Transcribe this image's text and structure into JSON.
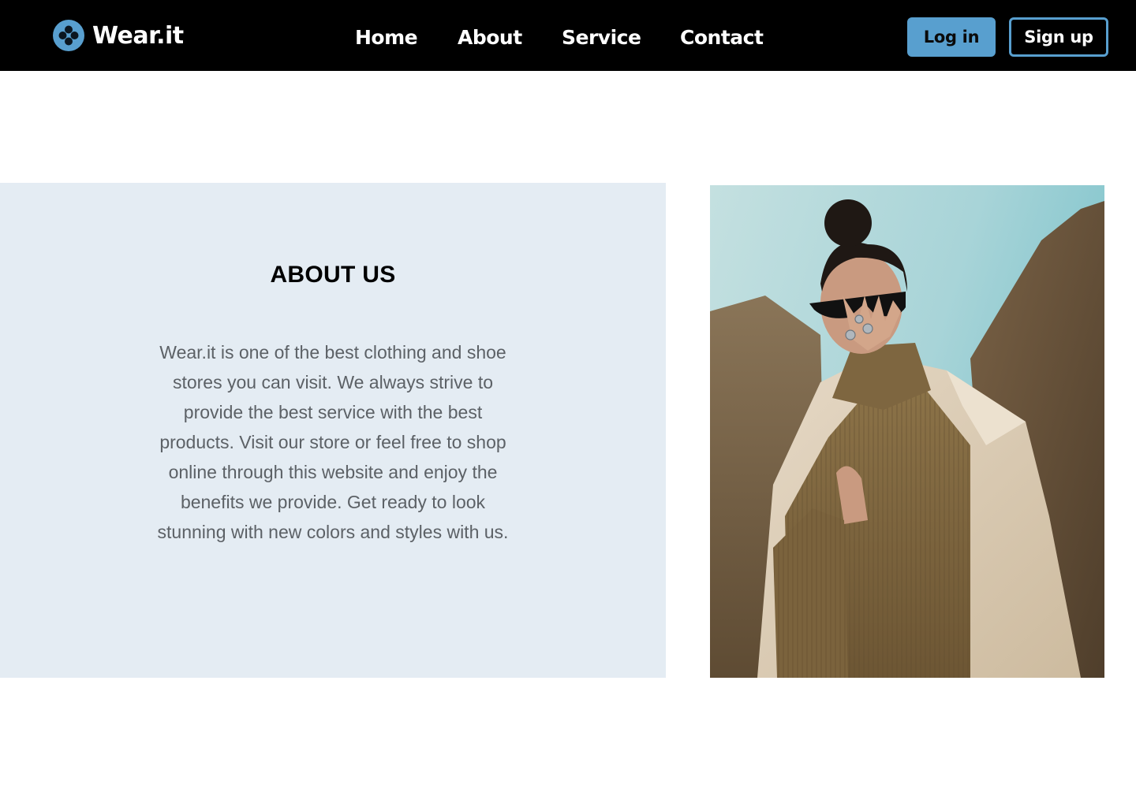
{
  "header": {
    "brand_name": "Wear.it",
    "nav": {
      "home": "Home",
      "about": "About",
      "service": "Service",
      "contact": "Contact"
    },
    "login_label": "Log in",
    "signup_label": "Sign up"
  },
  "about": {
    "title": "ABOUT US",
    "body": "Wear.it is one of the best clothing and shoe stores you can visit. We always strive to provide the best service with the best products. Visit our store or feel free to shop online through this website and enjoy the benefits we provide. Get ready to look stunning with new colors and styles with us."
  },
  "colors": {
    "nav_background": "#000000",
    "accent": "#589fcf",
    "about_panel": "#e4ecf3",
    "body_text": "#5c6166"
  },
  "icons": {
    "brand": "clover-logo-icon"
  }
}
